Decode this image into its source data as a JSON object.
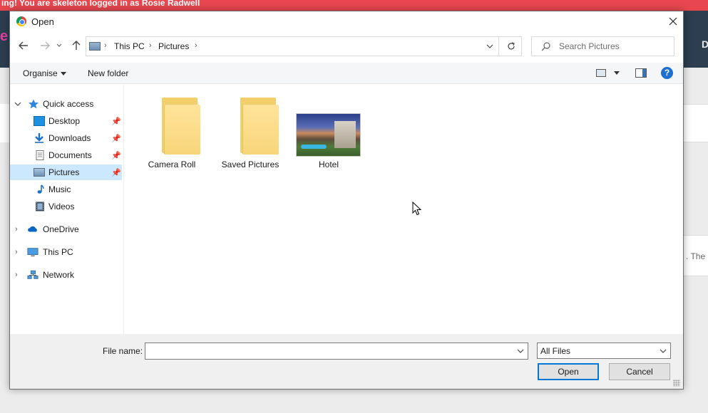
{
  "background_page": {
    "banner_text": "ing! You are skeleton logged in as Rosie Radwell",
    "logo_fragment": "e",
    "nav_fragment": "D",
    "text_fragment": ". The r"
  },
  "dialog": {
    "title": "Open",
    "address": {
      "crumbs": [
        "This PC",
        "Pictures"
      ]
    },
    "search": {
      "placeholder": "Search Pictures"
    },
    "toolbar": {
      "organise_label": "Organise",
      "new_folder_label": "New folder",
      "help_label": "?"
    },
    "nav": {
      "quick_access": "Quick access",
      "desktop": "Desktop",
      "downloads": "Downloads",
      "documents": "Documents",
      "pictures": "Pictures",
      "music": "Music",
      "videos": "Videos",
      "onedrive": "OneDrive",
      "this_pc": "This PC",
      "network": "Network"
    },
    "files": [
      {
        "name": "Camera Roll",
        "type": "folder"
      },
      {
        "name": "Saved Pictures",
        "type": "folder"
      },
      {
        "name": "Hotel",
        "type": "image"
      }
    ],
    "bottom": {
      "file_name_label": "File name:",
      "file_name_value": "",
      "filter_value": "All Files",
      "open_label": "Open",
      "cancel_label": "Cancel"
    }
  },
  "colors": {
    "banner": "#e8474f",
    "header": "#2c3e50",
    "selection": "#cce8ff",
    "accent": "#0078d7"
  }
}
